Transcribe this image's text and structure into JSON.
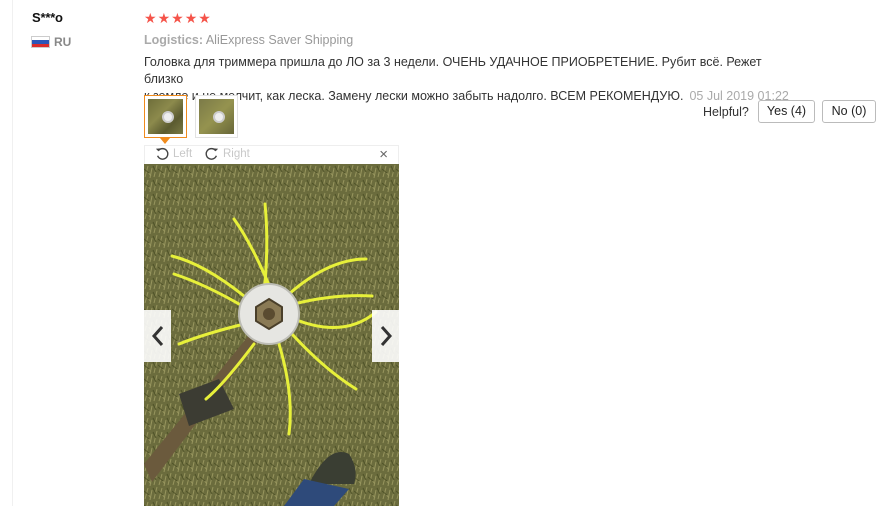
{
  "review": {
    "username": "S***o",
    "country": "RU",
    "rating": 5,
    "logistics_label": "Logistics:",
    "logistics_value": "AliExpress Saver Shipping",
    "text_line1": "Головка для триммера пришла до ЛО за 3 недели. ОЧЕНЬ УДАЧНОЕ ПРИОБРЕТЕНИЕ. Рубит всё. Режет близко",
    "text_line2": "к земле и не мелчит, как леска. Замену лески можно забыть надолго. ВСЕМ РЕКОМЕНДУЮ.",
    "date": "05 Jul 2019 01:22"
  },
  "helpful": {
    "label": "Helpful?",
    "yes_label": "Yes (4)",
    "no_label": "No (0)"
  },
  "viewer": {
    "rotate_left": "Left",
    "rotate_right": "Right",
    "close": "×"
  },
  "colors": {
    "star": "#f5544a",
    "thumb_selected_border": "#f08b1d",
    "trimmer_line": "#e7f03a"
  }
}
